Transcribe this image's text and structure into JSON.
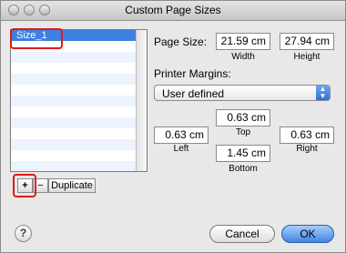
{
  "window": {
    "title": "Custom Page Sizes"
  },
  "list": {
    "items": [
      "Size_1"
    ],
    "selected_index": 0
  },
  "list_buttons": {
    "add_label": "+",
    "remove_label": "−",
    "duplicate_label": "Duplicate"
  },
  "page_size": {
    "label": "Page Size:",
    "width_value": "21.59 cm",
    "width_caption": "Width",
    "height_value": "27.94 cm",
    "height_caption": "Height"
  },
  "printer_margins": {
    "label": "Printer Margins:",
    "preset_selected": "User defined",
    "top_value": "0.63 cm",
    "top_caption": "Top",
    "left_value": "0.63 cm",
    "left_caption": "Left",
    "right_value": "0.63 cm",
    "right_caption": "Right",
    "bottom_value": "1.45 cm",
    "bottom_caption": "Bottom"
  },
  "footer": {
    "help_label": "?",
    "cancel_label": "Cancel",
    "ok_label": "OK"
  },
  "colors": {
    "selection": "#3d80df",
    "highlight_box": "#e01a1a",
    "default_button": "#3f86e6"
  }
}
